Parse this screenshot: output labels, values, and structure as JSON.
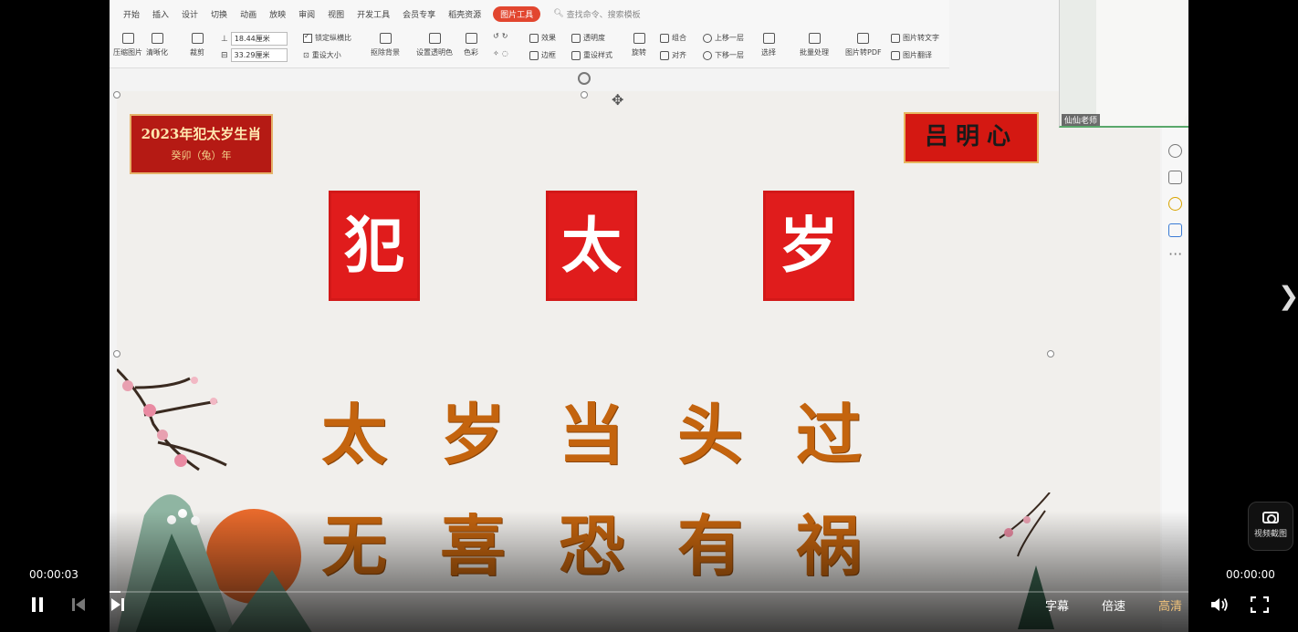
{
  "ribbon": {
    "tabs": [
      "开始",
      "插入",
      "设计",
      "切换",
      "动画",
      "放映",
      "审阅",
      "视图",
      "开发工具",
      "会员专享",
      "稻壳资源"
    ],
    "active_tab": "图片工具",
    "search_placeholder": "查找命令、搜索模板",
    "tools": {
      "compress": "压缩图片",
      "clarity": "清晰化",
      "crop": "裁剪",
      "width": "18.44厘米",
      "height": "33.29厘米",
      "lock_ratio": "锁定纵横比",
      "reset_size": "重设大小",
      "remove_bg": "抠除背景",
      "set_transparent": "设置透明色",
      "color": "色彩",
      "effects": "效果",
      "transparency": "透明度",
      "border": "边框",
      "reset_style": "重设样式",
      "rotate": "旋转",
      "group": "组合",
      "align": "对齐",
      "bring_forward": "上移一层",
      "send_backward": "下移一层",
      "select": "选择",
      "batch": "批量处理",
      "to_pdf": "图片转PDF",
      "to_text": "图片转文字",
      "translate": "图片翻译"
    }
  },
  "slide": {
    "badge_left_line1": "2023年犯太岁生肖",
    "badge_left_line2": "癸卯（兔）年",
    "badge_right": "吕明心",
    "seals": [
      "犯",
      "太",
      "岁"
    ],
    "verse_line1": "太岁当头过",
    "verse_line2": "无喜恐有祸"
  },
  "webcam": {
    "name": "仙仙老师"
  },
  "player": {
    "current_time": "00:00:03",
    "duration": "00:00:00",
    "progress": 0.01,
    "subtitle_label": "字幕",
    "speed_label": "倍速",
    "quality_label": "高清",
    "snapshot_label": "视频截图",
    "next_glyph": "❯"
  }
}
